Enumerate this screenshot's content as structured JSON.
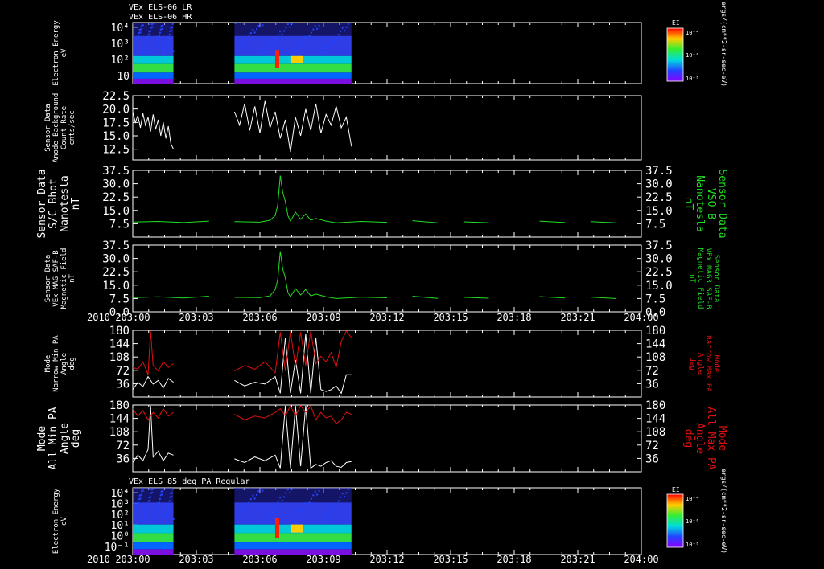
{
  "header": {
    "line1": "VEx ELS-06 LR",
    "line2": "VEx ELS-06 HR",
    "panel7_title": "VEx ELS 85 deg PA Regular"
  },
  "time_axis": {
    "year": "2010",
    "ticks": [
      "203:00",
      "203:03",
      "203:06",
      "203:09",
      "203:12",
      "203:15",
      "203:18",
      "203:21",
      "204:00"
    ]
  },
  "colorbar": {
    "label": "EI",
    "ticks": [
      "10⁻⁴",
      "10⁻⁶",
      "10⁻⁸"
    ],
    "unit": "ergs/(cm**2-sr-sec-eV)"
  },
  "colors": {
    "background": "#000000",
    "frame": "#ffffff",
    "green": "#22dd22",
    "red": "#e01010",
    "white": "#ffffff"
  },
  "chart_data": [
    {
      "type": "heatmap",
      "panel": "p1",
      "ylabel": [
        "Electron Energy",
        "eV"
      ],
      "yticks": [
        "10⁴",
        "10³",
        "10²",
        "10"
      ],
      "yscale": "log",
      "data_intervals": [
        [
          0.0,
          0.08
        ],
        [
          0.2,
          0.43
        ]
      ]
    },
    {
      "type": "line",
      "panel": "p2",
      "ylabel": [
        "Sensor Data",
        "Anode Background",
        "Count Rate",
        "cnts/sec"
      ],
      "yticks": [
        "22.5",
        "20.0",
        "17.5",
        "15.0",
        "12.5"
      ],
      "ylim": [
        10.5,
        22.5
      ],
      "series": [
        {
          "color": "white",
          "x": [
            0.0,
            0.005,
            0.01,
            0.015,
            0.02,
            0.025,
            0.03,
            0.035,
            0.04,
            0.045,
            0.05,
            0.055,
            0.06,
            0.065,
            0.07,
            0.075,
            0.08
          ],
          "y": [
            19.5,
            17.5,
            18.8,
            16.5,
            19.2,
            17.0,
            18.5,
            15.8,
            19.0,
            16.2,
            18.0,
            15.0,
            17.5,
            14.5,
            16.8,
            13.5,
            12.5
          ]
        },
        {
          "color": "white",
          "x": [
            0.2,
            0.21,
            0.22,
            0.23,
            0.24,
            0.25,
            0.26,
            0.27,
            0.28,
            0.29,
            0.3,
            0.31,
            0.32,
            0.33,
            0.34,
            0.35,
            0.36,
            0.37,
            0.38,
            0.39,
            0.4,
            0.41,
            0.42,
            0.43
          ],
          "y": [
            19.5,
            17.0,
            21.0,
            16.0,
            20.5,
            15.5,
            21.5,
            16.5,
            19.5,
            14.5,
            18.0,
            12.0,
            18.5,
            15.0,
            20.0,
            16.0,
            21.0,
            15.5,
            19.0,
            17.0,
            20.5,
            16.5,
            18.5,
            13.0
          ]
        }
      ]
    },
    {
      "type": "line",
      "panel": "p3",
      "ylabel": [
        "Sensor Data",
        "S/C Bhot",
        "Nanotesla",
        "nT"
      ],
      "ylabel_right": [
        "Sensor Data",
        "VSO B",
        "Nanotesla",
        "nT"
      ],
      "yticks": [
        "37.5",
        "30.0",
        "22.5",
        "15.0",
        "7.5"
      ],
      "ylim": [
        0,
        37.5
      ],
      "series": [
        {
          "color": "green",
          "x": [
            0.0,
            0.05,
            0.1,
            0.15,
            0.2,
            0.25,
            0.27,
            0.28,
            0.285,
            0.29,
            0.295,
            0.3,
            0.305,
            0.31,
            0.32,
            0.33,
            0.34,
            0.35,
            0.36,
            0.38,
            0.4,
            0.45,
            0.5,
            0.55,
            0.6,
            0.65,
            0.7,
            0.75,
            0.8,
            0.85,
            0.9,
            0.95,
            1.0
          ],
          "y": [
            8.5,
            8.8,
            8.2,
            9.0,
            8.7,
            8.4,
            9.5,
            12.0,
            18.0,
            34.5,
            25.0,
            20.0,
            12.0,
            9.0,
            14.0,
            10.0,
            13.0,
            9.5,
            10.5,
            9.0,
            8.0,
            8.8,
            8.3,
            9.2,
            8.0,
            8.6,
            8.1,
            7.5,
            9.0,
            8.2,
            8.7,
            8.0,
            8.5
          ]
        }
      ]
    },
    {
      "type": "line",
      "panel": "p4",
      "ylabel": [
        "Sensor Data",
        "VEx MAG SAF-B",
        "Magnetic Field",
        "nT"
      ],
      "ylabel_right": [
        "Sensor Data",
        "VEx MAG3 SAF-B",
        "Magnetic Field",
        "nT"
      ],
      "yticks": [
        "37.5",
        "30.0",
        "22.5",
        "15.0",
        "7.5",
        "0.0"
      ],
      "ylim": [
        0,
        37.5
      ],
      "series": [
        {
          "color": "green",
          "x": [
            0.0,
            0.05,
            0.1,
            0.15,
            0.2,
            0.25,
            0.27,
            0.28,
            0.285,
            0.29,
            0.295,
            0.3,
            0.305,
            0.31,
            0.32,
            0.33,
            0.34,
            0.35,
            0.36,
            0.38,
            0.4,
            0.45,
            0.5,
            0.55,
            0.6,
            0.65,
            0.7,
            0.75,
            0.8,
            0.85,
            0.9,
            0.95,
            1.0
          ],
          "y": [
            8.0,
            8.5,
            7.8,
            8.8,
            8.2,
            8.0,
            9.0,
            12.5,
            18.0,
            34.0,
            24.0,
            19.0,
            11.0,
            8.5,
            13.0,
            9.5,
            12.5,
            9.0,
            10.0,
            8.5,
            7.5,
            8.3,
            7.9,
            8.8,
            7.6,
            8.2,
            7.7,
            7.0,
            8.6,
            7.8,
            8.3,
            7.5,
            8.0
          ]
        }
      ]
    },
    {
      "type": "line",
      "panel": "p5",
      "ylabel": [
        "Mode",
        "Narrow Min PA",
        "Angle",
        "deg"
      ],
      "ylabel_right": [
        "Mode",
        "Narrow Max PA",
        "Angle",
        "deg"
      ],
      "yticks": [
        "180",
        "144",
        "108",
        "72",
        "36"
      ],
      "ylim": [
        0,
        180
      ],
      "series": [
        {
          "name": "min",
          "color": "white",
          "x": [
            0.0,
            0.01,
            0.02,
            0.03,
            0.04,
            0.05,
            0.06,
            0.07,
            0.08,
            0.2,
            0.22,
            0.24,
            0.26,
            0.28,
            0.29,
            0.3,
            0.31,
            0.32,
            0.33,
            0.34,
            0.35,
            0.36,
            0.37,
            0.38,
            0.39,
            0.4,
            0.41,
            0.42,
            0.43
          ],
          "y": [
            20,
            40,
            28,
            55,
            35,
            45,
            25,
            50,
            40,
            45,
            30,
            40,
            35,
            55,
            10,
            160,
            10,
            100,
            10,
            170,
            10,
            160,
            20,
            15,
            20,
            30,
            10,
            60,
            60
          ]
        },
        {
          "name": "max",
          "color": "red",
          "x": [
            0.0,
            0.01,
            0.02,
            0.03,
            0.035,
            0.04,
            0.05,
            0.06,
            0.07,
            0.08,
            0.2,
            0.22,
            0.24,
            0.26,
            0.28,
            0.29,
            0.3,
            0.31,
            0.32,
            0.33,
            0.34,
            0.35,
            0.36,
            0.37,
            0.38,
            0.39,
            0.4,
            0.41,
            0.42,
            0.43
          ],
          "y": [
            80,
            75,
            95,
            60,
            178,
            85,
            70,
            95,
            80,
            90,
            70,
            85,
            75,
            95,
            65,
            175,
            70,
            178,
            80,
            175,
            85,
            178,
            90,
            110,
            95,
            120,
            80,
            150,
            178,
            160
          ]
        }
      ]
    },
    {
      "type": "line",
      "panel": "p6",
      "ylabel": [
        "Mode",
        "All Min PA",
        "Angle",
        "deg"
      ],
      "ylabel_right": [
        "Mode",
        "All Max PA",
        "Angle",
        "deg"
      ],
      "yticks": [
        "180",
        "144",
        "108",
        "72",
        "36"
      ],
      "ylim": [
        0,
        180
      ],
      "series": [
        {
          "name": "min",
          "color": "white",
          "x": [
            0.0,
            0.01,
            0.02,
            0.03,
            0.035,
            0.04,
            0.05,
            0.06,
            0.07,
            0.08,
            0.2,
            0.22,
            0.24,
            0.26,
            0.28,
            0.29,
            0.3,
            0.31,
            0.32,
            0.33,
            0.34,
            0.35,
            0.36,
            0.37,
            0.38,
            0.39,
            0.4,
            0.41,
            0.42,
            0.43
          ],
          "y": [
            25,
            45,
            30,
            60,
            178,
            40,
            55,
            30,
            50,
            45,
            35,
            25,
            40,
            30,
            45,
            10,
            178,
            10,
            178,
            15,
            178,
            10,
            20,
            15,
            25,
            30,
            15,
            12,
            25,
            28
          ]
        },
        {
          "name": "max",
          "color": "red",
          "x": [
            0.0,
            0.01,
            0.02,
            0.03,
            0.04,
            0.05,
            0.06,
            0.07,
            0.08,
            0.2,
            0.22,
            0.24,
            0.26,
            0.28,
            0.29,
            0.3,
            0.31,
            0.32,
            0.33,
            0.34,
            0.35,
            0.36,
            0.37,
            0.38,
            0.39,
            0.4,
            0.41,
            0.42,
            0.43
          ],
          "y": [
            170,
            150,
            165,
            140,
            160,
            145,
            170,
            150,
            160,
            155,
            140,
            150,
            145,
            160,
            170,
            150,
            178,
            150,
            178,
            160,
            178,
            140,
            160,
            145,
            150,
            130,
            140,
            160,
            155
          ]
        }
      ]
    },
    {
      "type": "heatmap",
      "panel": "p7",
      "ylabel": [
        "Electron Energy",
        "eV"
      ],
      "yticks": [
        "10⁴",
        "10³",
        "10²",
        "10¹",
        "10⁰",
        "10⁻¹"
      ],
      "yscale": "log",
      "data_intervals": [
        [
          0.0,
          0.08
        ],
        [
          0.2,
          0.43
        ]
      ]
    }
  ]
}
